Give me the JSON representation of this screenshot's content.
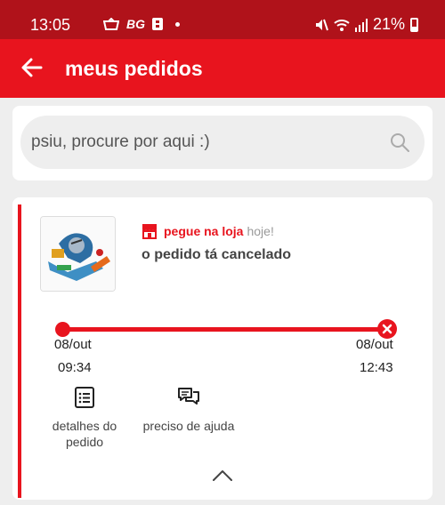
{
  "statusbar": {
    "time": "13:05",
    "left_text": "BG",
    "battery": "21%"
  },
  "header": {
    "title": "meus pedidos"
  },
  "search": {
    "placeholder": "psiu, procure por aqui :)"
  },
  "order": {
    "delivery_label": "pegue na loja",
    "delivery_when": "hoje!",
    "status": "o pedido tá cancelado",
    "timeline": {
      "start": {
        "date": "08/out",
        "time": "09:34"
      },
      "end": {
        "date": "08/out",
        "time": "12:43"
      }
    },
    "actions": [
      {
        "label": "detalhes do pedido",
        "icon": "document-list-icon"
      },
      {
        "label": "preciso de ajuda",
        "icon": "chat-bubbles-icon"
      }
    ]
  },
  "colors": {
    "status_bar": "#b0121a",
    "brand_red": "#e8141e",
    "background": "#eeeeee"
  }
}
